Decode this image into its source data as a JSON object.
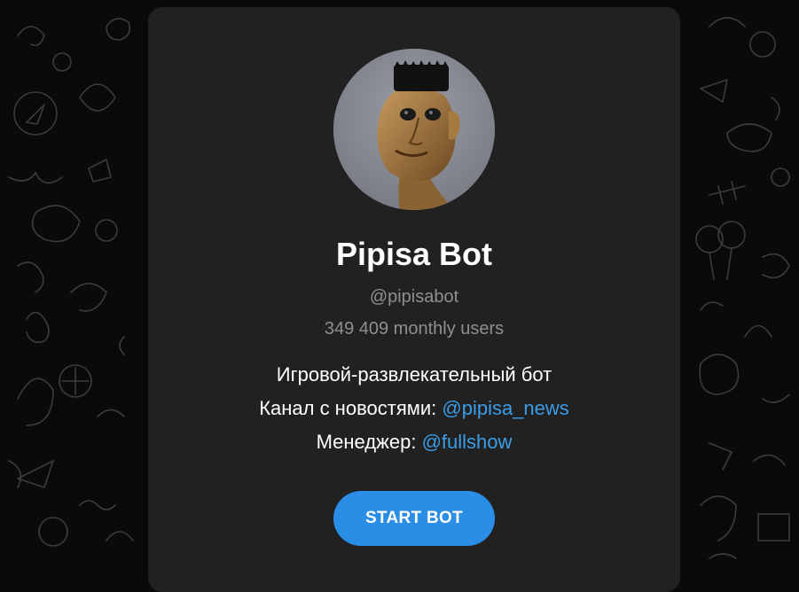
{
  "bot": {
    "name": "Pipisa Bot",
    "username": "@pipisabot",
    "monthly_users": "349 409 monthly users",
    "avatar_icon": "bot-avatar-portrait"
  },
  "description": {
    "line1": "Игровой-развлекательный бот",
    "line2_prefix": "Канал с новостями: ",
    "line2_link": "@pipisa_news",
    "line3_prefix": "Менеджер: ",
    "line3_link": "@fullshow"
  },
  "actions": {
    "start_label": "START BOT"
  },
  "colors": {
    "card_bg": "#212121",
    "page_bg": "#0a0a0a",
    "accent": "#2a8ee6",
    "link": "#3b9de8",
    "muted_text": "#8f8f8f"
  }
}
